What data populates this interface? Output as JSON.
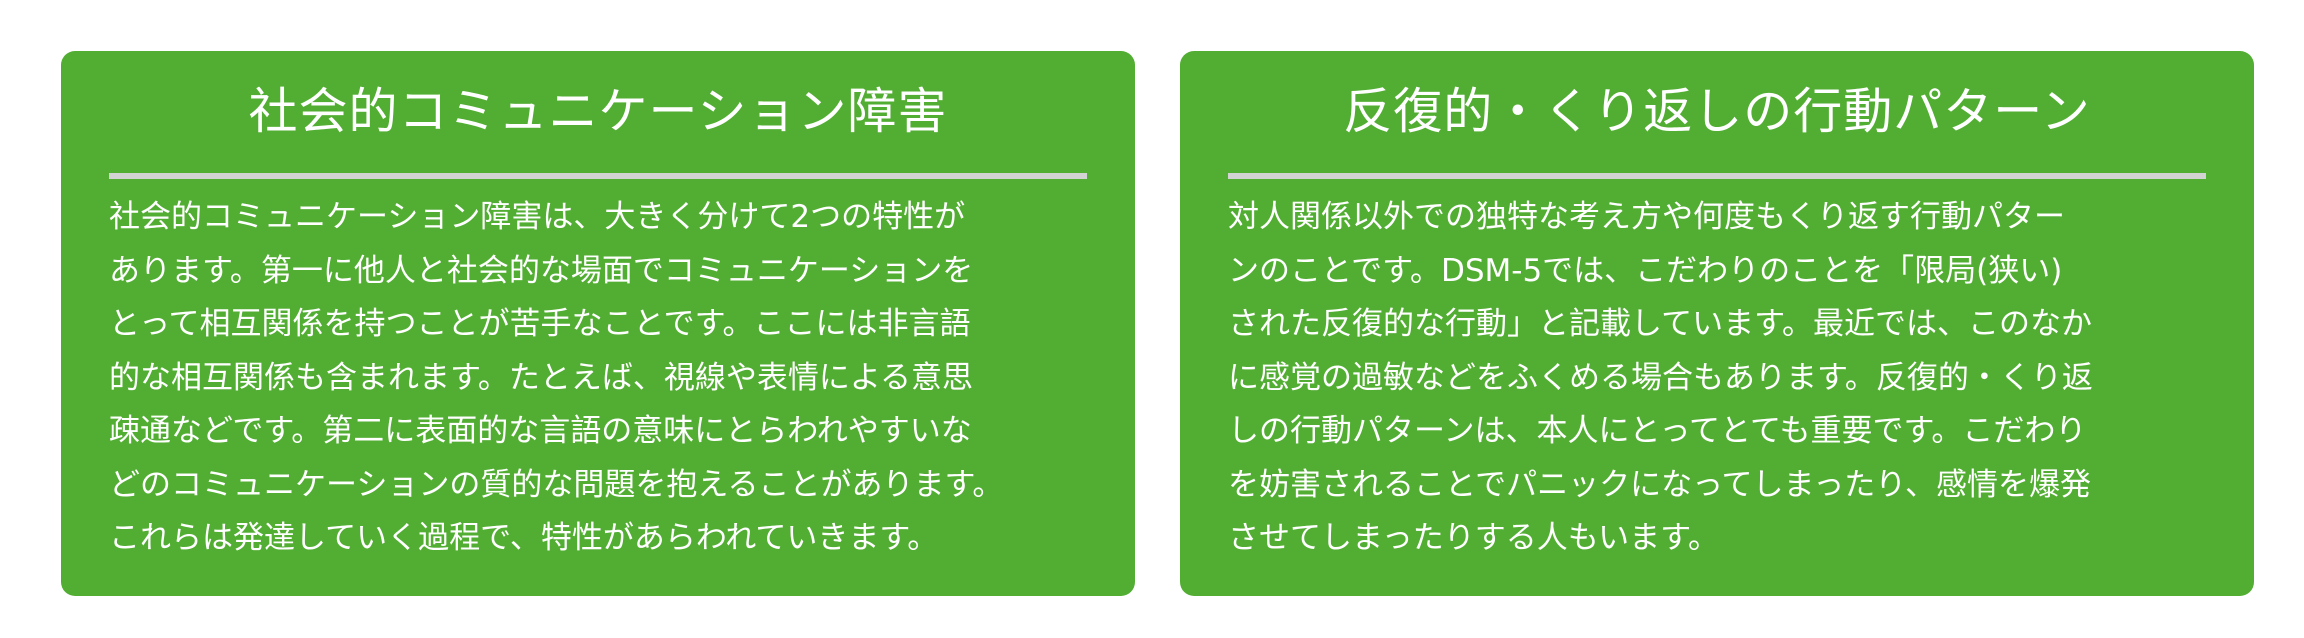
{
  "cards": [
    {
      "title": "社会的コミュニケーション障害",
      "lines": [
        "社会的コミュニケーション障害は、大きく分けて2つの特性が",
        "あります。第一に他人と社会的な場面でコミュニケーションを",
        "とって相互関係を持つことが苦手なことです。ここには非言語",
        "的な相互関係も含まれます。たとえば、視線や表情による意思",
        "疎通などです。第二に表面的な言語の意味にとらわれやすいな",
        "どのコミュニケーションの質的な問題を抱えることがあります。",
        "これらは発達していく過程で、特性があらわれていきます。"
      ]
    },
    {
      "title": "反復的・くり返しの行動パターン",
      "lines": [
        "対人関係以外での独特な考え方や何度もくり返す行動パター",
        "ンのことです。DSM-5では、こだわりのことを「限局(狭い)",
        "された反復的な行動」と記載しています。最近では、このなか",
        "に感覚の過敏などをふくめる場合もあります。反復的・くり返",
        "しの行動パターンは、本人にとってとても重要です。こだわり",
        "を妨害されることでパニックになってしまったり、感情を爆発",
        "させてしまったりする人もいます。"
      ]
    }
  ],
  "colors": {
    "card_background": "#52ae32",
    "text": "#ffffff",
    "divider": "#d3d3d3"
  }
}
